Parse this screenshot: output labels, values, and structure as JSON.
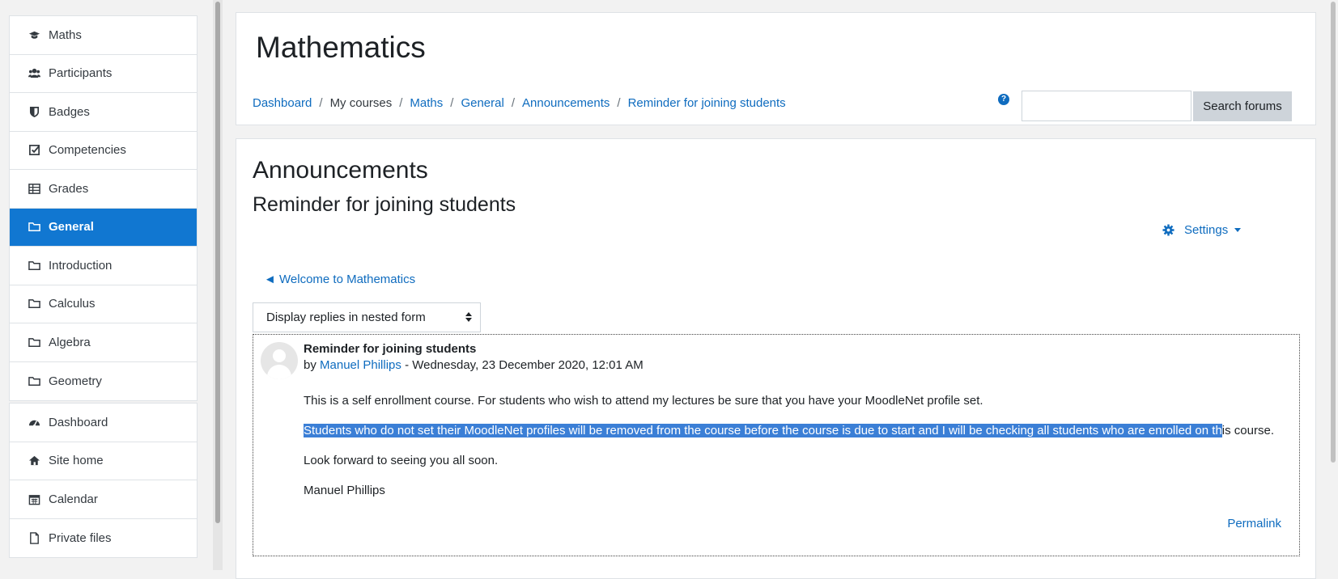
{
  "sidebar": {
    "group1": [
      {
        "label": "Maths",
        "icon": "graduation-cap-icon",
        "active": false
      },
      {
        "label": "Participants",
        "icon": "users-icon",
        "active": false
      },
      {
        "label": "Badges",
        "icon": "shield-icon",
        "active": false
      },
      {
        "label": "Competencies",
        "icon": "check-square-icon",
        "active": false
      },
      {
        "label": "Grades",
        "icon": "table-icon",
        "active": false
      },
      {
        "label": "General",
        "icon": "folder-icon",
        "active": true
      },
      {
        "label": "Introduction",
        "icon": "folder-icon",
        "active": false
      },
      {
        "label": "Calculus",
        "icon": "folder-icon",
        "active": false
      },
      {
        "label": "Algebra",
        "icon": "folder-icon",
        "active": false
      },
      {
        "label": "Geometry",
        "icon": "folder-icon",
        "active": false
      }
    ],
    "group2": [
      {
        "label": "Dashboard",
        "icon": "tachometer-icon"
      },
      {
        "label": "Site home",
        "icon": "home-icon"
      },
      {
        "label": "Calendar",
        "icon": "calendar-icon"
      },
      {
        "label": "Private files",
        "icon": "file-icon"
      }
    ]
  },
  "header": {
    "title": "Mathematics",
    "breadcrumb": {
      "dashboard": "Dashboard",
      "my_courses": "My courses",
      "maths": "Maths",
      "general": "General",
      "announcements": "Announcements",
      "current": "Reminder for joining students"
    },
    "help_glyph": "?",
    "search_placeholder": "",
    "search_button": "Search forums"
  },
  "content": {
    "forum_title": "Announcements",
    "discussion_title": "Reminder for joining students",
    "settings_label": "Settings",
    "prev_link": "◄ Welcome to Mathematics",
    "display_mode": "Display replies in nested form",
    "post": {
      "subject": "Reminder for joining students",
      "by": "by",
      "author": "Manuel Phillips",
      "date": "- Wednesday, 23 December 2020, 12:01 AM",
      "para1": "This is a self enrollment course. For students who wish to attend my lectures be sure that you have your MoodleNet profile set.",
      "para2_selected": "Students who do not set their MoodleNet profiles will be  removed from the course before the course is due to start and I will be checking all students who are enrolled on th",
      "para2_rest": "is course.",
      "para3": "Look forward to seeing you all soon.",
      "signature": "Manuel Phillips",
      "permalink": "Permalink"
    }
  },
  "colors": {
    "accent": "#0f6cbf",
    "active_nav": "#1177d1",
    "selection": "#3b7fd6"
  }
}
